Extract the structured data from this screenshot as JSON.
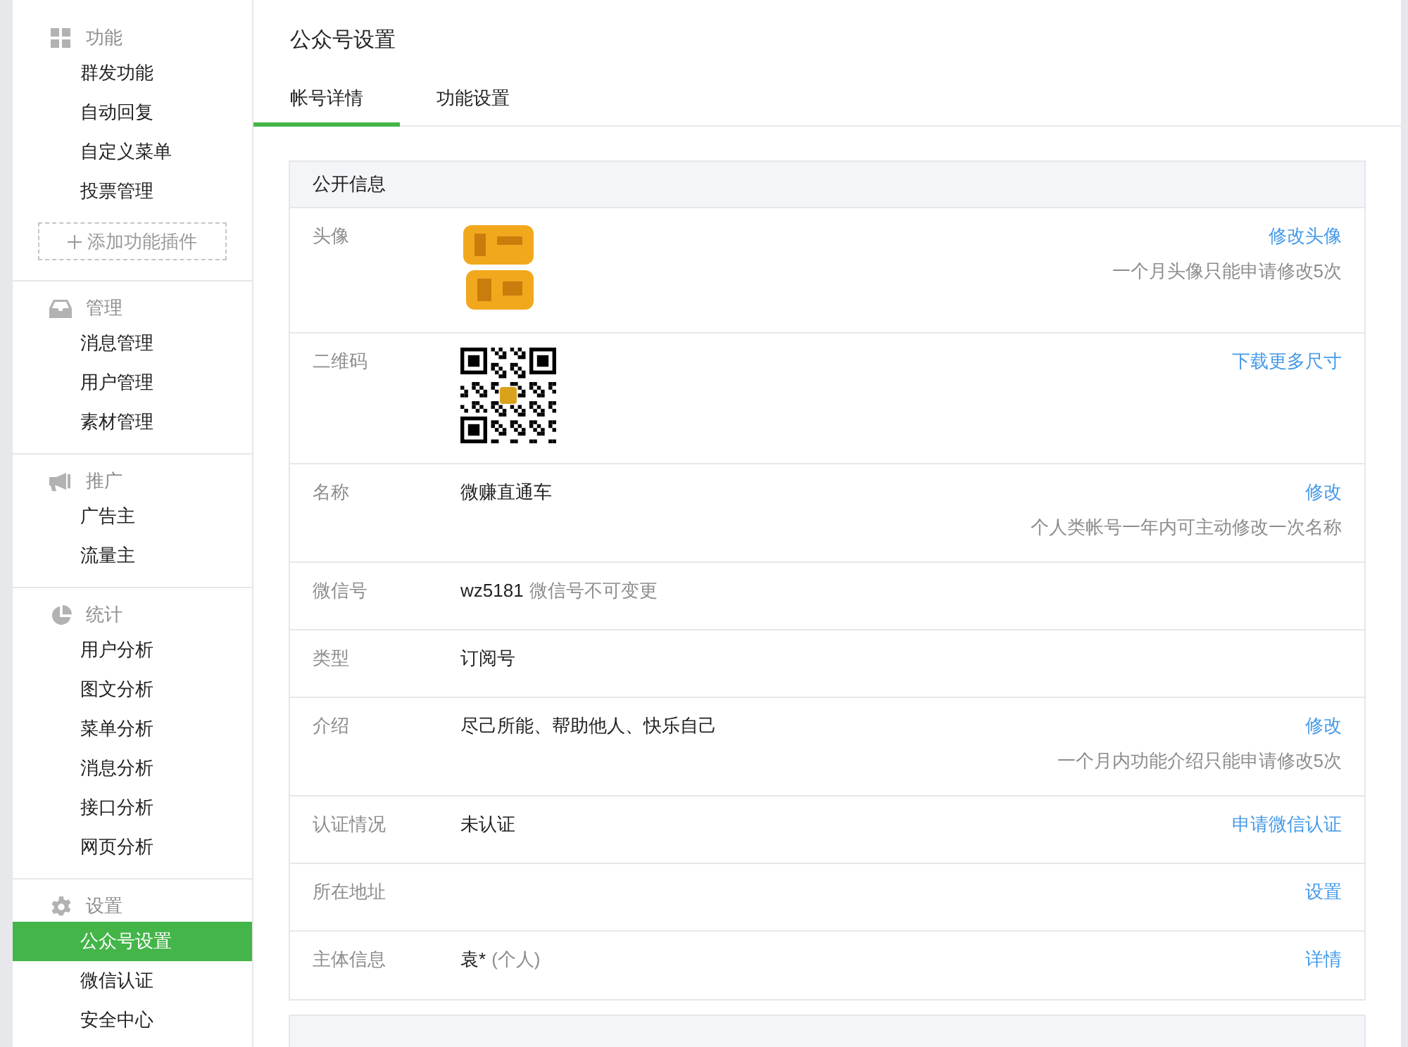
{
  "sidebar": {
    "sections": [
      {
        "title": "功能",
        "kind": "grid",
        "items": [
          {
            "label": "群发功能",
            "selected": false
          },
          {
            "label": "自动回复",
            "selected": false
          },
          {
            "label": "自定义菜单",
            "selected": false
          },
          {
            "label": "投票管理",
            "selected": false
          }
        ],
        "add_button": "添加功能插件"
      },
      {
        "title": "管理",
        "kind": "inbox",
        "items": [
          {
            "label": "消息管理",
            "selected": false
          },
          {
            "label": "用户管理",
            "selected": false
          },
          {
            "label": "素材管理",
            "selected": false
          }
        ]
      },
      {
        "title": "推广",
        "kind": "megaphone",
        "items": [
          {
            "label": "广告主",
            "selected": false
          },
          {
            "label": "流量主",
            "selected": false
          }
        ]
      },
      {
        "title": "统计",
        "kind": "pie",
        "items": [
          {
            "label": "用户分析",
            "selected": false
          },
          {
            "label": "图文分析",
            "selected": false
          },
          {
            "label": "菜单分析",
            "selected": false
          },
          {
            "label": "消息分析",
            "selected": false
          },
          {
            "label": "接口分析",
            "selected": false
          },
          {
            "label": "网页分析",
            "selected": false
          }
        ]
      },
      {
        "title": "设置",
        "kind": "gear",
        "items": [
          {
            "label": "公众号设置",
            "selected": true
          },
          {
            "label": "微信认证",
            "selected": false
          },
          {
            "label": "安全中心",
            "selected": false
          }
        ]
      }
    ]
  },
  "page_title": "公众号设置",
  "tabs": [
    {
      "label": "帐号详情",
      "selected": true
    },
    {
      "label": "功能设置",
      "selected": false
    }
  ],
  "public_info": {
    "title": "公开信息",
    "rows": [
      {
        "label": "头像",
        "kind": "picture",
        "action": "修改头像",
        "hint": "一个月头像只能申请修改5次"
      },
      {
        "label": "二维码",
        "kind": "qrcode",
        "action": "下载更多尺寸"
      },
      {
        "label": "名称",
        "kind": "text",
        "value": "微赚直通车",
        "action": "修改",
        "hint": "个人类帐号一年内可主动修改一次名称"
      },
      {
        "label": "微信号",
        "kind": "text",
        "value": "wz5181",
        "value_note": "微信号不可变更"
      },
      {
        "label": "类型",
        "kind": "text",
        "value": "订阅号"
      },
      {
        "label": "介绍",
        "kind": "text",
        "value": "尽己所能、帮助他人、快乐自己",
        "action": "修改",
        "hint": "一个月内功能介绍只能申请修改5次"
      },
      {
        "label": "认证情况",
        "kind": "text",
        "value": "未认证",
        "action": "申请微信认证"
      },
      {
        "label": "所在地址",
        "kind": "text",
        "action": "设置"
      },
      {
        "label": "主体信息",
        "kind": "text",
        "value": "袁*",
        "value_note": "(个人)",
        "action": "详情"
      }
    ]
  }
}
